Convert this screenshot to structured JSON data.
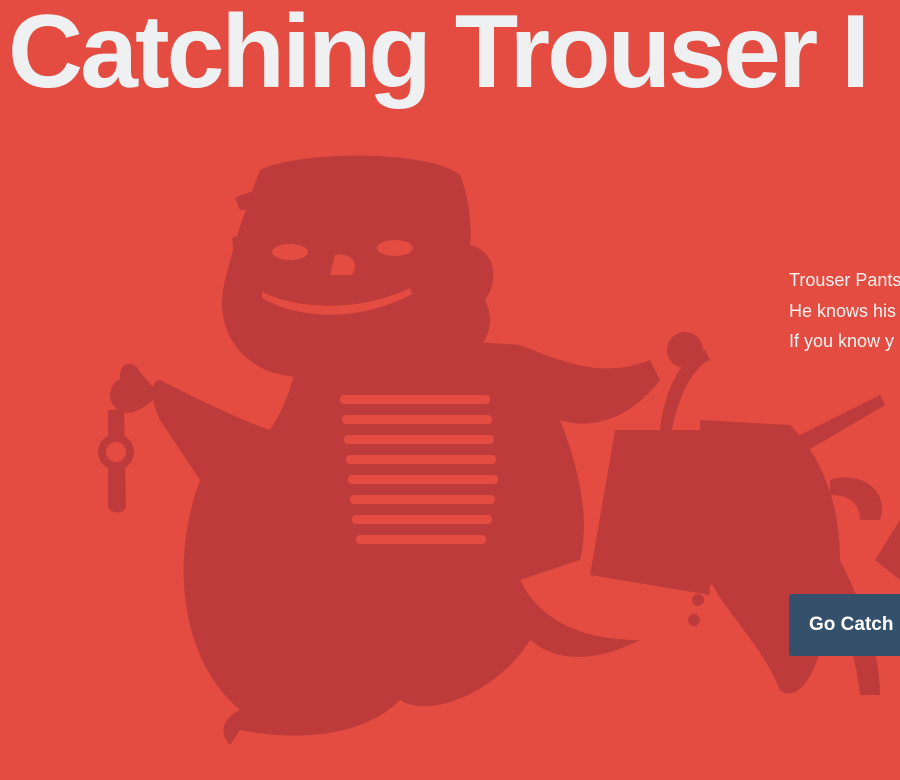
{
  "page": {
    "title": "Catching Trouser I",
    "background_color": "#e44c41",
    "illustration_color": "#bd3b3b"
  },
  "hero": {
    "illustration_icon": "masked-thief-illustration",
    "tagline_lines": [
      "Trouser Pants",
      "He knows his",
      "If you know y"
    ],
    "cta_label": "Go Catch",
    "cta_color": "#35506b"
  }
}
